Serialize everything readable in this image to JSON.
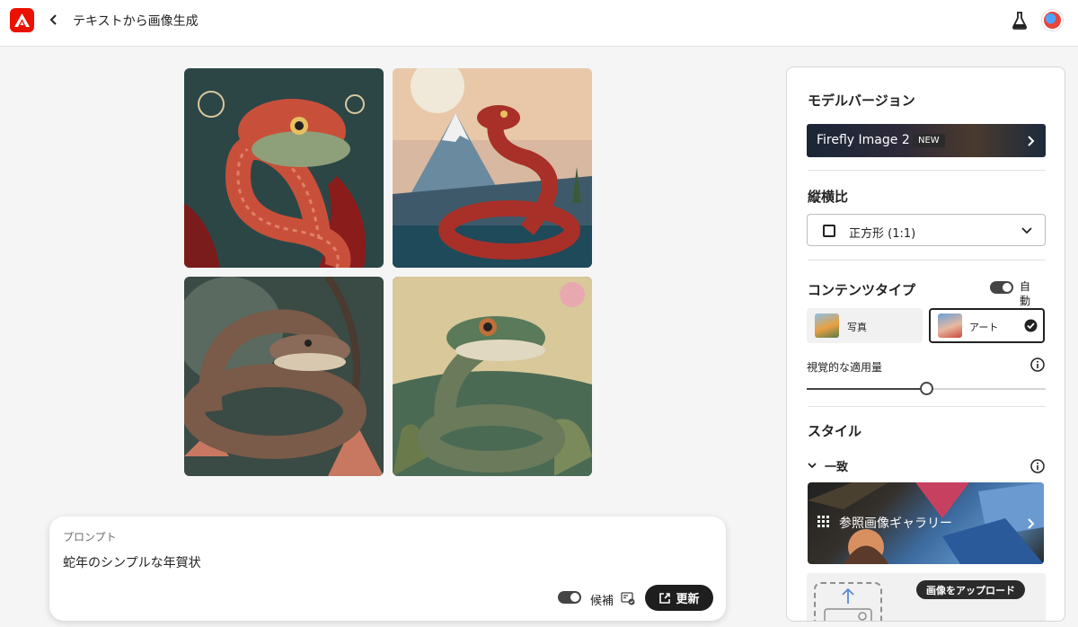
{
  "header": {
    "title": "テキストから画像生成",
    "logo_icon": "adobe-firefly-logo",
    "back_icon": "chevron-left-icon",
    "labs_icon": "flask-icon",
    "avatar_icon": "user-avatar"
  },
  "images": [
    {
      "subject": "snake",
      "palette": [
        "#2e4a4a",
        "#c8503a",
        "#f0e2c6"
      ]
    },
    {
      "subject": "snake",
      "palette": [
        "#4a6a7a",
        "#b03a30",
        "#e8c8a0"
      ]
    },
    {
      "subject": "snake",
      "palette": [
        "#3a4a42",
        "#8a6a5a",
        "#d8c8b0"
      ]
    },
    {
      "subject": "snake",
      "palette": [
        "#4a5a3a",
        "#6a7a5a",
        "#e0d8b0"
      ]
    }
  ],
  "prompt": {
    "label": "プロンプト",
    "text": "蛇年のシンプルな年賀状",
    "candidates_label": "候補",
    "refresh_label": "更新"
  },
  "panel": {
    "model_version": {
      "title": "モデルバージョン",
      "model_name": "Firefly Image 2",
      "badge": "NEW"
    },
    "aspect_ratio": {
      "title": "縦横比",
      "selected": "正方形 (1:1)"
    },
    "content_type": {
      "title": "コンテンツタイプ",
      "auto_label": "自動",
      "options": [
        {
          "label": "写真",
          "selected": false
        },
        {
          "label": "アート",
          "selected": true
        }
      ],
      "visual_intensity_label": "視覚的な適用量",
      "visual_intensity_value": 0.5
    },
    "style": {
      "title": "スタイル",
      "match_label": "一致",
      "gallery_label": "参照画像ギャラリー",
      "upload_label": "画像をアップロード"
    }
  },
  "colors": {
    "accent": "#eb1000",
    "dark_button": "#1e1e1e"
  }
}
